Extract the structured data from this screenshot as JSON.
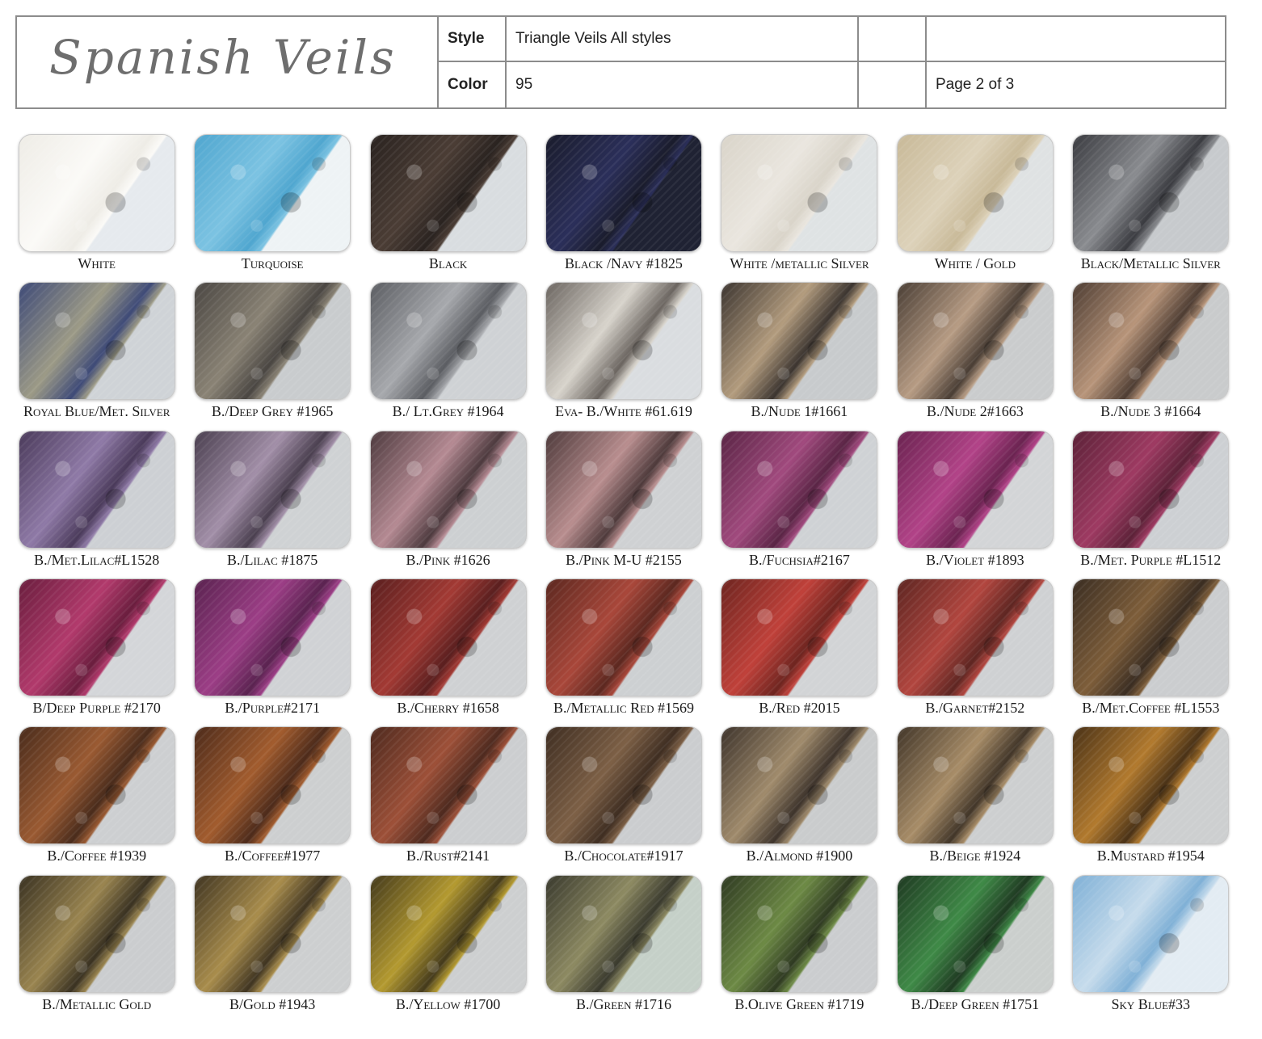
{
  "header": {
    "brand": "Spanish Veils",
    "style_label": "Style",
    "style_value": "Triangle Veils All styles",
    "color_label": "Color",
    "color_value": "95",
    "page": "Page 2 of 3"
  },
  "swatches": [
    {
      "label": "White",
      "base": "#eeece6",
      "lace": "#fbfaf7",
      "split": "#e6eaee"
    },
    {
      "label": "Turquoise",
      "base": "#4fa6cf",
      "lace": "#7cc3e2",
      "split": "#eef3f5"
    },
    {
      "label": "Black",
      "base": "#2a2320",
      "lace": "#4b3d35",
      "split": "#d9dde0"
    },
    {
      "label": "Black /Navy #1825",
      "base": "#1a1c2c",
      "lace": "#2b2f5a",
      "split": "#1f2233"
    },
    {
      "label": "White /metallic Silver",
      "base": "#d9d4c9",
      "lace": "#eae6df",
      "split": "#dfe3e4"
    },
    {
      "label": "White / Gold",
      "base": "#c8b998",
      "lace": "#ddd2ba",
      "split": "#dfe2e3"
    },
    {
      "label": "Black/Metallic Silver",
      "base": "#3a3b40",
      "lace": "#8a8c90",
      "split": "#c7cacd"
    },
    {
      "label": "Royal Blue/Met. Silver",
      "base": "#3e4a77",
      "lace": "#9c9a86",
      "split": "#cfd3d7"
    },
    {
      "label": "B./Deep Grey #1965",
      "base": "#4a4642",
      "lace": "#8a8375",
      "split": "#c9ccce"
    },
    {
      "label": "B./ Lt.Grey #1964",
      "base": "#5b5d62",
      "lace": "#a7a9ad",
      "split": "#cfd2d5"
    },
    {
      "label": "Eva- B./White #61.619",
      "base": "#6b6560",
      "lace": "#d8d4cc",
      "split": "#dadde0"
    },
    {
      "label": "B./Nude 1#1661",
      "base": "#3c3530",
      "lace": "#b39c7e",
      "split": "#c8cbcd"
    },
    {
      "label": "B./Nude 2#1663",
      "base": "#4a3e35",
      "lace": "#b79c84",
      "split": "#cacccd"
    },
    {
      "label": "B./Nude 3 #1664",
      "base": "#4e3d33",
      "lace": "#b8957a",
      "split": "#c9cbcc"
    },
    {
      "label": "B./Met.Lilac#L1528",
      "base": "#4a3a5a",
      "lace": "#8f7aa7",
      "split": "#cdd0d4"
    },
    {
      "label": "B./Lilac #1875",
      "base": "#4a3f4f",
      "lace": "#a28fa8",
      "split": "#cfd2d4"
    },
    {
      "label": "B./Pink #1626",
      "base": "#4d3a3e",
      "lace": "#b58a93",
      "split": "#cdd0d2"
    },
    {
      "label": "B./Pink M-U #2155",
      "base": "#4e3a3b",
      "lace": "#b98e8f",
      "split": "#cfd1d3"
    },
    {
      "label": "B./Fuchsia#2167",
      "base": "#5a2545",
      "lace": "#a14a7e",
      "split": "#cfd2d5"
    },
    {
      "label": "B./Violet #1893",
      "base": "#6a2350",
      "lace": "#b24388",
      "split": "#d3d5d7"
    },
    {
      "label": "B./Met. Purple #L1512",
      "base": "#5c2238",
      "lace": "#9e3a62",
      "split": "#cdd0d3"
    },
    {
      "label": "B/Deep Purple #2170",
      "base": "#6a1e3e",
      "lace": "#b23a6c",
      "split": "#d4d6d9"
    },
    {
      "label": "B./Purple#2171",
      "base": "#5a2350",
      "lace": "#9c3e86",
      "split": "#d0d2d5"
    },
    {
      "label": "B./Cherry #1658",
      "base": "#5a1f1f",
      "lace": "#a33a34",
      "split": "#cfd1d3"
    },
    {
      "label": "B./Metallic Red #1569",
      "base": "#5c2820",
      "lace": "#a9473a",
      "split": "#cdd0d2"
    },
    {
      "label": "B./Red #2015",
      "base": "#6e2520",
      "lace": "#c0413a",
      "split": "#d2d4d6"
    },
    {
      "label": "B./Garnet#2152",
      "base": "#5e2622",
      "lace": "#b2463f",
      "split": "#cfd1d3"
    },
    {
      "label": "B./Met.Coffee #L1553",
      "base": "#3a2d22",
      "lace": "#7e5e3a",
      "split": "#cbcdcf"
    },
    {
      "label": "B./Coffee #1939",
      "base": "#4a2c1c",
      "lace": "#9a5a32",
      "split": "#cdcfd1"
    },
    {
      "label": "B./Coffee#1977",
      "base": "#4d2b1b",
      "lace": "#a25c2e",
      "split": "#cdcfd0"
    },
    {
      "label": "B./Rust#2141",
      "base": "#4e2a1f",
      "lace": "#9d5038",
      "split": "#ccced0"
    },
    {
      "label": "B./Chocolate#1917",
      "base": "#3f2e22",
      "lace": "#7d6046",
      "split": "#cbcdcf"
    },
    {
      "label": "B./Almond #1900",
      "base": "#3e342c",
      "lace": "#a08b6c",
      "split": "#cacccd"
    },
    {
      "label": "B./Beige #1924",
      "base": "#423629",
      "lace": "#a88d68",
      "split": "#cdcfd0"
    },
    {
      "label": "B.Mustard #1954",
      "base": "#4a3217",
      "lace": "#b27a2e",
      "split": "#cdcfd0"
    },
    {
      "label": "B./Metallic Gold",
      "base": "#3a3222",
      "lace": "#9a8550",
      "split": "#cbcdcf"
    },
    {
      "label": "B/Gold #1943",
      "base": "#403522",
      "lace": "#a98d4c",
      "split": "#cdcfd0"
    },
    {
      "label": "B./Yellow #1700",
      "base": "#443a1c",
      "lace": "#b49a30",
      "split": "#cdcfd0"
    },
    {
      "label": "B./Green #1716",
      "base": "#3a3a2e",
      "lace": "#8d8a62",
      "split": "#c5d0c8"
    },
    {
      "label": "B.Olive Green #1719",
      "base": "#2f3a22",
      "lace": "#6d8a45",
      "split": "#cbcdcf"
    },
    {
      "label": "B./Deep Green #1751",
      "base": "#1f3a22",
      "lace": "#3f8a47",
      "split": "#cbcfcd"
    },
    {
      "label": "Sky Blue#33",
      "base": "#7fb0d6",
      "lace": "#c7dcec",
      "split": "#e3ecf3"
    }
  ]
}
